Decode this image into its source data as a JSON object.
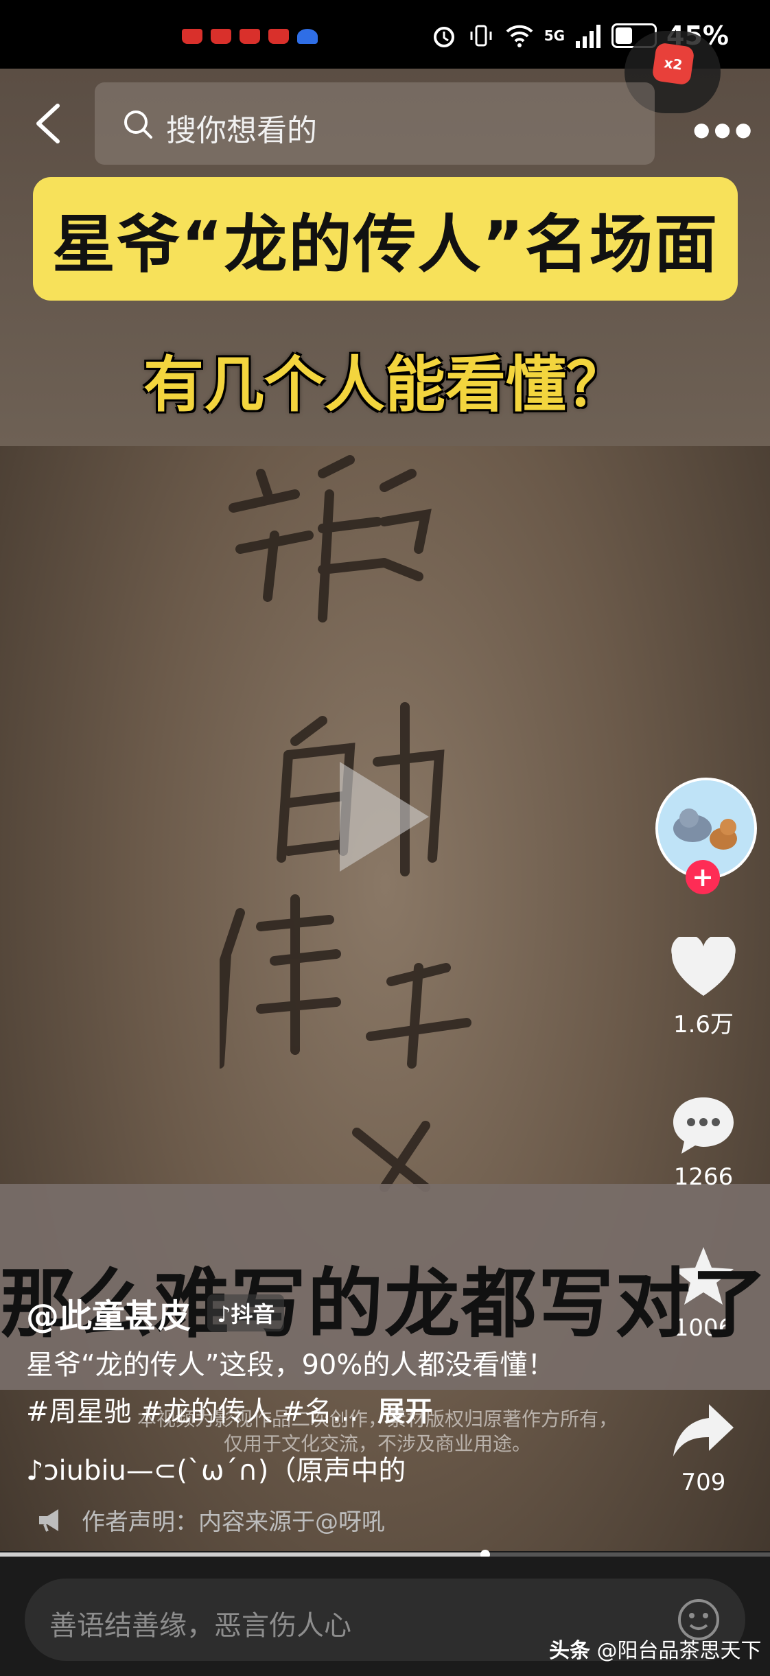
{
  "status_bar": {
    "network": "5G",
    "battery": "45%",
    "battery_level": 0.45
  },
  "reward_badge": {
    "label": "x2"
  },
  "search": {
    "placeholder": "搜你想看的"
  },
  "video": {
    "title_banner": "星爷“龙的传人”名场面",
    "subtitle": "有几个人能看懂？",
    "caption": "那么难写的龙都写对了",
    "watermark_line1": "本视频为影视作品二次创作，素材版权归原著作方所有，",
    "watermark_line2": "仅用于文化交流，不涉及商业用途。"
  },
  "actions": {
    "likes": "1.6万",
    "comments": "1266",
    "favorites": "1006",
    "shares": "709"
  },
  "post": {
    "author": "@此童甚皮",
    "platform": "♪抖音",
    "description": "星爷“龙的传人”这段，90%的人都没看懂！#周星驰 #龙的传人 #名...",
    "expand_label": "展开",
    "music": "♪ɔiubiu—⊂(`ω´∩)（原声中的",
    "declaration": "作者声明：内容来源于@呀吼"
  },
  "playback": {
    "progress": 0.63
  },
  "comment_bar": {
    "placeholder": "善语结善缘，恶言伤人心"
  },
  "source": {
    "label": "头条",
    "account": "@阳台品茶思天下"
  }
}
